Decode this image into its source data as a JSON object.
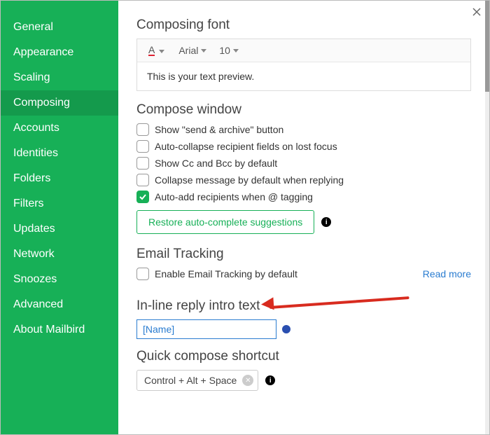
{
  "sidebar": {
    "items": [
      {
        "label": "General"
      },
      {
        "label": "Appearance"
      },
      {
        "label": "Scaling"
      },
      {
        "label": "Composing"
      },
      {
        "label": "Accounts"
      },
      {
        "label": "Identities"
      },
      {
        "label": "Folders"
      },
      {
        "label": "Filters"
      },
      {
        "label": "Updates"
      },
      {
        "label": "Network"
      },
      {
        "label": "Snoozes"
      },
      {
        "label": "Advanced"
      },
      {
        "label": "About Mailbird"
      }
    ],
    "selected_index": 3
  },
  "sections": {
    "composing_font": {
      "title": "Composing font",
      "font_family": "Arial",
      "font_size": "10",
      "preview": "This is your text preview."
    },
    "compose_window": {
      "title": "Compose window",
      "options": [
        {
          "label": "Show \"send & archive\" button",
          "checked": false
        },
        {
          "label": "Auto-collapse recipient fields on lost focus",
          "checked": false
        },
        {
          "label": "Show Cc and Bcc by default",
          "checked": false
        },
        {
          "label": "Collapse message by default when replying",
          "checked": false
        },
        {
          "label": "Auto-add recipients when @ tagging",
          "checked": true
        }
      ],
      "restore_button": "Restore auto-complete suggestions"
    },
    "email_tracking": {
      "title": "Email Tracking",
      "option_label": "Enable Email Tracking by default",
      "option_checked": false,
      "read_more": "Read more"
    },
    "inline_reply": {
      "title": "In-line reply intro text",
      "value": "[Name]"
    },
    "quick_compose": {
      "title": "Quick compose shortcut",
      "value": "Control + Alt + Space"
    }
  }
}
